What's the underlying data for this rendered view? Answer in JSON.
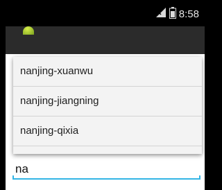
{
  "status_bar": {
    "time": "8:58",
    "signal_icon": "signal-icon",
    "battery_icon": "battery-icon"
  },
  "autocomplete": {
    "suggestions": [
      "nanjing-xuanwu",
      "nanjing-jiangning",
      "nanjing-qixia"
    ]
  },
  "input": {
    "value": "na",
    "underline_color": "#33b5e5"
  }
}
